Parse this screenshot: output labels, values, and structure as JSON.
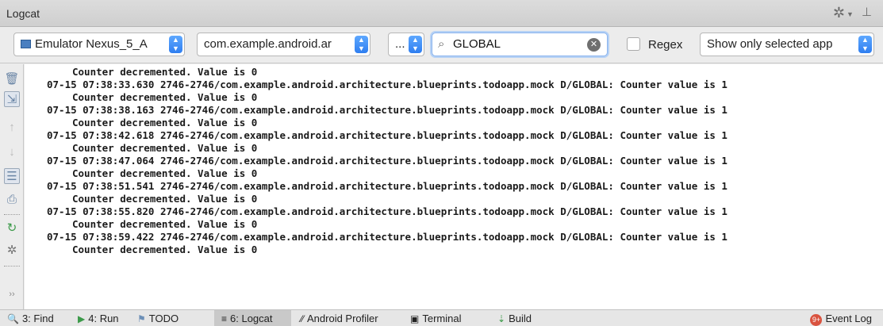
{
  "window": {
    "title": "Logcat"
  },
  "toolbar": {
    "device": "Emulator Nexus_5_A",
    "process": "com.example.android.ar",
    "log_level": "...",
    "search_value": "GLOBAL",
    "regex_label": "Regex",
    "filter": "Show only selected app"
  },
  "log_lines": [
    "Counter decremented. Value is 0",
    "07-15 07:38:33.630 2746-2746/com.example.android.architecture.blueprints.todoapp.mock D/GLOBAL: Counter value is 1",
    "Counter decremented. Value is 0",
    "07-15 07:38:38.163 2746-2746/com.example.android.architecture.blueprints.todoapp.mock D/GLOBAL: Counter value is 1",
    "Counter decremented. Value is 0",
    "07-15 07:38:42.618 2746-2746/com.example.android.architecture.blueprints.todoapp.mock D/GLOBAL: Counter value is 1",
    "Counter decremented. Value is 0",
    "07-15 07:38:47.064 2746-2746/com.example.android.architecture.blueprints.todoapp.mock D/GLOBAL: Counter value is 1",
    "Counter decremented. Value is 0",
    "07-15 07:38:51.541 2746-2746/com.example.android.architecture.blueprints.todoapp.mock D/GLOBAL: Counter value is 1",
    "Counter decremented. Value is 0",
    "07-15 07:38:55.820 2746-2746/com.example.android.architecture.blueprints.todoapp.mock D/GLOBAL: Counter value is 1",
    "Counter decremented. Value is 0",
    "07-15 07:38:59.422 2746-2746/com.example.android.architecture.blueprints.todoapp.mock D/GLOBAL: Counter value is 1",
    "Counter decremented. Value is 0"
  ],
  "statusbar": {
    "find": "3: Find",
    "run": "4: Run",
    "todo": "TODO",
    "logcat": "6: Logcat",
    "profiler": "Android Profiler",
    "terminal": "Terminal",
    "build": "Build",
    "event_log": "Event Log",
    "event_badge": "9+"
  },
  "colors": {
    "accent": "#2f7ef0",
    "badge": "#d9533f"
  }
}
